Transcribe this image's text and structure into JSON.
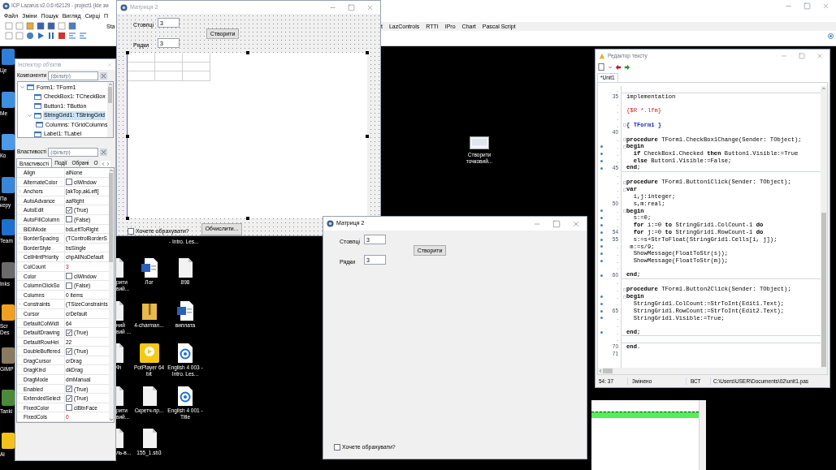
{
  "ide": {
    "title": "ICP Lazarus v2.0.6 r62129 - project1 (Ide зм",
    "menu": [
      "Файл",
      "Зміни",
      "Пошук",
      "Вигляд",
      "Сирці",
      "П"
    ],
    "palette_cut": "Sta",
    "palette_tabs": [
      "t",
      "LazControls",
      "RTTI",
      "IPro",
      "Chart",
      "Pascal Script"
    ]
  },
  "desktop_left": [
    {
      "label": "Це",
      "color": "#2f7fd8"
    },
    {
      "label": "Ме",
      "color": "#3d8fe0"
    },
    {
      "label": "Ко",
      "color": "#4a9ae6"
    },
    {
      "label": "Па керу",
      "color": "#3a86d8"
    },
    {
      "label": "Team",
      "color": "#1f6fd1"
    },
    {
      "label": "Inks",
      "color": "#6b6b6b"
    },
    {
      "label": "Scr Des",
      "color": "#f0a020"
    },
    {
      "label": "GIMP",
      "color": "#8a7a60"
    },
    {
      "label": "Tanki",
      "color": "#4a8a3a"
    },
    {
      "label": "Al",
      "color": "#f2c21a"
    }
  ],
  "desktop_fragment": "- Intro. Les...",
  "desktop_icons": [
    {
      "label": "рити вий...",
      "kind": "doc"
    },
    {
      "label": "Лог",
      "kind": "word"
    },
    {
      "label": "898",
      "kind": "doc"
    },
    {
      "label": "ний вий ...",
      "kind": "doc"
    },
    {
      "label": "4-charman...",
      "kind": "zip"
    },
    {
      "label": "виплата",
      "kind": "word"
    },
    {
      "label": "Фі",
      "kind": "doc"
    },
    {
      "label": "PotPlayer 64 bit",
      "kind": "player"
    },
    {
      "label": "English 4 003 - Intro. Les...",
      "kind": "disc"
    },
    {
      "label": "рити вий...",
      "kind": "doc"
    },
    {
      "label": "Скретч-пр...",
      "kind": "doc"
    },
    {
      "label": "English 4 001 - Title",
      "kind": "disc"
    },
    {
      "label": "ль-в...",
      "kind": "doc"
    },
    {
      "label": "155_1.sb3",
      "kind": "doc"
    }
  ],
  "desktop_shortcut": {
    "label": "Створити точковий..."
  },
  "object_inspector": {
    "title": "Інспектор об'єктів",
    "components_label": "Компоненти",
    "components_placeholder": "(фільтр)",
    "tree": [
      {
        "label": "Form1: TForm1",
        "selected": false,
        "expanded": true,
        "children": [
          {
            "label": "CheckBox1: TCheckBox",
            "selected": false
          },
          {
            "label": "Button1: TButton",
            "selected": false
          },
          {
            "label": "StringGrid1: TStringGrid",
            "selected": true,
            "expanded": true,
            "children": [
              {
                "label": "Columns: TGridColumns",
                "selected": false
              }
            ]
          },
          {
            "label": "Label1: TLabel",
            "selected": false
          }
        ]
      }
    ],
    "properties_label": "Властивості",
    "properties_placeholder": "(фільтр)",
    "tabs": [
      {
        "label": "Властивості",
        "selected": true
      },
      {
        "label": "Події",
        "selected": false
      },
      {
        "label": "Обрані",
        "selected": false
      },
      {
        "label": "О",
        "selected": false
      }
    ],
    "properties": [
      {
        "name": "Align",
        "value": "alNone",
        "kind": "text",
        "expandable": false,
        "modified": false
      },
      {
        "name": "AlternateColor",
        "value": "clWindow",
        "kind": "color",
        "expandable": false,
        "modified": false
      },
      {
        "name": "Anchors",
        "value": "[akTop,akLeft]",
        "kind": "text",
        "expandable": true,
        "modified": false
      },
      {
        "name": "AutoAdvance",
        "value": "aaRight",
        "kind": "text",
        "expandable": false,
        "modified": false
      },
      {
        "name": "AutoEdit",
        "value": "(True)",
        "kind": "check",
        "checked": true,
        "expandable": false,
        "modified": false
      },
      {
        "name": "AutoFillColumn",
        "value": "(False)",
        "kind": "check",
        "checked": false,
        "expandable": false,
        "modified": false
      },
      {
        "name": "BiDiMode",
        "value": "bdLeftToRight",
        "kind": "text",
        "expandable": false,
        "modified": false
      },
      {
        "name": "BorderSpacing",
        "value": "(TControlBorderS",
        "kind": "text",
        "expandable": true,
        "modified": false
      },
      {
        "name": "BorderStyle",
        "value": "bsSingle",
        "kind": "text",
        "expandable": false,
        "modified": false
      },
      {
        "name": "CellHintPriority",
        "value": "chpAllNoDefault",
        "kind": "text",
        "expandable": false,
        "modified": false
      },
      {
        "name": "ColCount",
        "value": "3",
        "kind": "text",
        "expandable": false,
        "modified": true
      },
      {
        "name": "Color",
        "value": "clWindow",
        "kind": "color",
        "expandable": false,
        "modified": false
      },
      {
        "name": "ColumnClickSo",
        "value": "(False)",
        "kind": "check",
        "checked": false,
        "expandable": false,
        "modified": false
      },
      {
        "name": "Columns",
        "value": "0 items",
        "kind": "text",
        "expandable": false,
        "modified": false
      },
      {
        "name": "Constraints",
        "value": "(TSizeConstraints",
        "kind": "text",
        "expandable": true,
        "modified": false
      },
      {
        "name": "Cursor",
        "value": "crDefault",
        "kind": "text",
        "expandable": false,
        "modified": false
      },
      {
        "name": "DefaultColWidt",
        "value": "64",
        "kind": "text",
        "expandable": false,
        "modified": false
      },
      {
        "name": "DefaultDrawing",
        "value": "(True)",
        "kind": "check",
        "checked": true,
        "expandable": false,
        "modified": false
      },
      {
        "name": "DefaultRowHei",
        "value": "22",
        "kind": "text",
        "expandable": false,
        "modified": false
      },
      {
        "name": "DoubleBuffered",
        "value": "(True)",
        "kind": "check",
        "checked": true,
        "expandable": false,
        "modified": false
      },
      {
        "name": "DragCursor",
        "value": "crDrag",
        "kind": "text",
        "expandable": false,
        "modified": false
      },
      {
        "name": "DragKind",
        "value": "dkDrag",
        "kind": "text",
        "expandable": false,
        "modified": false
      },
      {
        "name": "DragMode",
        "value": "dmManual",
        "kind": "text",
        "expandable": false,
        "modified": false
      },
      {
        "name": "Enabled",
        "value": "(True)",
        "kind": "check",
        "checked": true,
        "expandable": false,
        "modified": false
      },
      {
        "name": "ExtendedSelect",
        "value": "(True)",
        "kind": "check",
        "checked": true,
        "expandable": false,
        "modified": false
      },
      {
        "name": "FixedColor",
        "value": "clBtnFace",
        "kind": "color",
        "expandable": false,
        "modified": false
      },
      {
        "name": "FixedCols",
        "value": "0",
        "kind": "text",
        "expandable": false,
        "modified": true
      }
    ]
  },
  "designer": {
    "title": "Матриця 2",
    "columns_label": "Стовпці",
    "columns_value": "3",
    "rows_label": "Рядки",
    "rows_value": "3",
    "create_button": "Створити",
    "checkbox": {
      "label": "Хочете обрахувати?",
      "checked": false
    },
    "compute_button": "Обчислити..."
  },
  "running_form": {
    "title": "Матриця 2",
    "columns_label": "Стовпці",
    "columns_value": "3",
    "rows_label": "Рядки",
    "rows_value": "3",
    "create_button": "Створити",
    "checkbox": {
      "label": "Хочете обрахувати?",
      "checked": false
    }
  },
  "editor": {
    "title": "Редактор тексту",
    "tab": "*Unit1",
    "lines": [
      {
        "gutter": ".",
        "dot": false,
        "fold": false,
        "rule": true
      },
      {
        "gutter": "35",
        "text": "implementation",
        "kind": "code",
        "dot": false,
        "fold": false,
        "rule": false
      },
      {
        "gutter": ".",
        "dot": false,
        "fold": false,
        "rule": false
      },
      {
        "gutter": ".",
        "text": "{$R *.lfm}",
        "kind": "directive",
        "dot": false,
        "fold": false,
        "rule": false
      },
      {
        "gutter": ".",
        "dot": false,
        "fold": false,
        "rule": false
      },
      {
        "gutter": ".",
        "text": "{ TForm1 }",
        "kind": "comment",
        "dot": false,
        "fold": true,
        "rule": false
      },
      {
        "gutter": "40",
        "dot": false,
        "fold": false,
        "rule": false
      },
      {
        "gutter": ".",
        "text": "**procedure** TForm1.CheckBox1Change(Sender: TObject);",
        "kind": "code",
        "dot": false,
        "fold": true,
        "rule": false
      },
      {
        "gutter": ".",
        "text": "**begin**",
        "kind": "code",
        "dot": true,
        "fold": true,
        "rule": false
      },
      {
        "gutter": ".",
        "text": "  **if** CheckBox1.Checked **then** Button1.Visible:=True",
        "kind": "code",
        "dot": true,
        "fold": false,
        "rule": false
      },
      {
        "gutter": ".",
        "text": "  **else** Button1.Visible:=False;",
        "kind": "code",
        "dot": true,
        "fold": false,
        "rule": false
      },
      {
        "gutter": "45",
        "text": "**end**;",
        "kind": "code",
        "dot": true,
        "fold": false,
        "rule": true
      },
      {
        "gutter": ".",
        "dot": false,
        "fold": false,
        "rule": false
      },
      {
        "gutter": ".",
        "text": "**procedure** TForm1.Button1Click(Sender: TObject);",
        "kind": "code",
        "dot": false,
        "fold": true,
        "rule": false
      },
      {
        "gutter": ".",
        "text": "**var**",
        "kind": "code",
        "dot": false,
        "fold": true,
        "rule": false
      },
      {
        "gutter": ".",
        "text": "  i,j:integer;",
        "kind": "code",
        "dot": false,
        "fold": false,
        "rule": false
      },
      {
        "gutter": "50",
        "text": "  s,m:real;",
        "kind": "code",
        "dot": false,
        "fold": false,
        "rule": false
      },
      {
        "gutter": ".",
        "text": "**begin**",
        "kind": "code",
        "dot": true,
        "fold": true,
        "rule": false
      },
      {
        "gutter": ".",
        "text": "  s:=0;",
        "kind": "code",
        "dot": true,
        "fold": false,
        "rule": false
      },
      {
        "gutter": ".",
        "text": "  **for** i:=0 **to** StringGrid1.ColCount-1 **do**",
        "kind": "code",
        "dot": true,
        "fold": false,
        "rule": false
      },
      {
        "gutter": "54",
        "text": "  **for** j:=0 **to** StringGrid1.RowCount-1 **do**",
        "kind": "code",
        "dot": true,
        "fold": false,
        "rule": false
      },
      {
        "gutter": "55",
        "text": "  s:=s+StrToFloat(StringGrid1.Cells[i, j]);",
        "kind": "code",
        "dot": true,
        "fold": false,
        "rule": false
      },
      {
        "gutter": ".",
        "text": " m:=s/9;",
        "kind": "code",
        "dot": true,
        "fold": false,
        "rule": false
      },
      {
        "gutter": ".",
        "text": "  ShowMessage(FloatToStr(s));",
        "kind": "code",
        "dot": true,
        "fold": false,
        "rule": false
      },
      {
        "gutter": ".",
        "text": "  ShowMessage(FloatToStr(m));",
        "kind": "code",
        "dot": true,
        "fold": false,
        "rule": false
      },
      {
        "gutter": ".",
        "dot": false,
        "fold": false,
        "rule": false
      },
      {
        "gutter": "60",
        "text": "**end**;",
        "kind": "code",
        "dot": true,
        "fold": false,
        "rule": true
      },
      {
        "gutter": ".",
        "dot": false,
        "fold": false,
        "rule": false
      },
      {
        "gutter": ".",
        "text": "**procedure** TForm1.Button2Click(Sender: TObject);",
        "kind": "code",
        "dot": false,
        "fold": true,
        "rule": false
      },
      {
        "gutter": ".",
        "text": "**begin**",
        "kind": "code",
        "dot": true,
        "fold": true,
        "rule": false
      },
      {
        "gutter": ".",
        "text": "  StringGrid1.ColCount:=StrToInt(Edit1.Text);",
        "kind": "code",
        "dot": true,
        "fold": false,
        "rule": false
      },
      {
        "gutter": "65",
        "text": "  StringGrid1.RowCount:=StrToInt(Edit2.Text);",
        "kind": "code",
        "dot": true,
        "fold": false,
        "rule": false
      },
      {
        "gutter": ".",
        "text": "  StringGrid1.Visible:=True;",
        "kind": "code",
        "dot": true,
        "fold": false,
        "rule": false
      },
      {
        "gutter": ".",
        "dot": false,
        "fold": false,
        "rule": false
      },
      {
        "gutter": ".",
        "text": "**end**;",
        "kind": "code",
        "dot": true,
        "fold": false,
        "rule": true
      },
      {
        "gutter": ".",
        "dot": false,
        "fold": false,
        "rule": true
      },
      {
        "gutter": "70",
        "text": "**end**.",
        "kind": "code",
        "dot": false,
        "fold": false,
        "rule": false
      },
      {
        "gutter": "71",
        "dot": false,
        "fold": false,
        "rule": false
      }
    ],
    "status": {
      "position": "54: 37",
      "state": "Змінено",
      "mode": "ВСТ",
      "path": "C:\\Users\\USER\\Documents\\02\\unit1.pas"
    }
  }
}
